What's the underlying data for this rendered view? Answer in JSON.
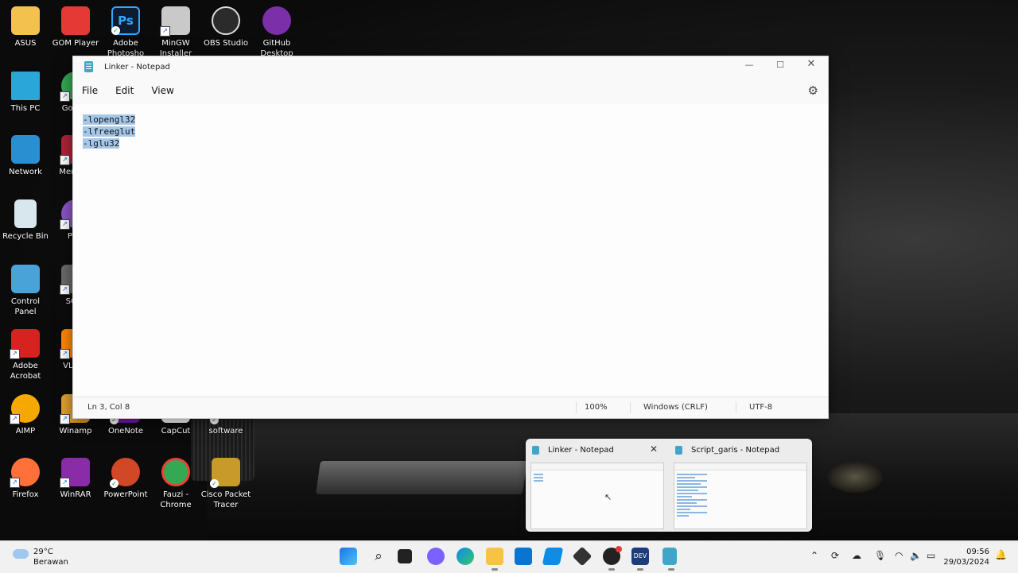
{
  "desktop": {
    "icons": [
      {
        "label": "ASUS",
        "icon": "folder-icon",
        "color": "#f2c14e"
      },
      {
        "label": "GOM Player",
        "icon": "gom-player-icon",
        "color": "#e53935"
      },
      {
        "label": "Adobe Photosho",
        "icon": "photoshop-icon",
        "color": "#0b1c33"
      },
      {
        "label": "MinGW Installer",
        "icon": "mingw-icon",
        "color": "#c9c9c9"
      },
      {
        "label": "OBS Studio",
        "icon": "obs-icon",
        "color": "#2b2b2b"
      },
      {
        "label": "GitHub Desktop",
        "icon": "github-icon",
        "color": "#7b2fa8"
      },
      {
        "label": "This PC",
        "icon": "monitor-icon",
        "color": "#2aa6d9"
      },
      {
        "label": "Go Chr",
        "icon": "chrome-icon",
        "color": "#34a853"
      },
      {
        "label": "Network",
        "icon": "network-icon",
        "color": "#2a8fd0"
      },
      {
        "label": "Mer Des",
        "icon": "mercury-icon",
        "color": "#b0243a"
      },
      {
        "label": "Recycle Bin",
        "icon": "recycle-bin-icon",
        "color": "#d8e6ee"
      },
      {
        "label": "Pica",
        "icon": "picasa-icon",
        "color": "#8b55c9"
      },
      {
        "label": "Control Panel",
        "icon": "control-panel-icon",
        "color": "#4aa3d8"
      },
      {
        "label": "SQLy",
        "icon": "sqlyog-icon",
        "color": "#6a6a6a"
      },
      {
        "label": "Adobe Acrobat",
        "icon": "acrobat-icon",
        "color": "#d7221f"
      },
      {
        "label": "VLC pl",
        "icon": "vlc-icon",
        "color": "#ff8800"
      },
      {
        "label": "AIMP",
        "icon": "aimp-icon",
        "color": "#f5a800"
      },
      {
        "label": "Winamp",
        "icon": "winamp-icon",
        "color": "#e0a030"
      },
      {
        "label": "OneNote",
        "icon": "onenote-icon",
        "color": "#7719aa"
      },
      {
        "label": "CapCut",
        "icon": "capcut-icon",
        "color": "#ffffff"
      },
      {
        "label": "software",
        "icon": "folder-icon",
        "color": "#f2c14e"
      },
      {
        "label": "Firefox",
        "icon": "firefox-icon",
        "color": "#ff7139"
      },
      {
        "label": "WinRAR",
        "icon": "winrar-icon",
        "color": "#8a2ba8"
      },
      {
        "label": "PowerPoint",
        "icon": "powerpoint-icon",
        "color": "#d24726"
      },
      {
        "label": "Fauzi - Chrome",
        "icon": "chrome-icon",
        "color": "#34a853"
      },
      {
        "label": "Cisco Packet Tracer",
        "icon": "packet-tracer-icon",
        "color": "#c79a2a"
      }
    ]
  },
  "notepad": {
    "title": "Linker - Notepad",
    "menu": [
      "File",
      "Edit",
      "View"
    ],
    "lines": [
      "-lopengl32",
      "-lfreeglut",
      "-lglu32"
    ],
    "status": {
      "position": "Ln 3, Col 8",
      "zoom": "100%",
      "line_ending": "Windows (CRLF)",
      "encoding": "UTF-8"
    }
  },
  "preview": {
    "windows": [
      {
        "title": "Linker - Notepad"
      },
      {
        "title": "Script_garis - Notepad"
      }
    ]
  },
  "taskbar": {
    "weather_temp": "29°C",
    "weather_desc": "Berawan",
    "time": "09:56",
    "date": "29/03/2024"
  },
  "colors": {
    "selection": "#a6c8e8",
    "accent": "#0067c0"
  }
}
